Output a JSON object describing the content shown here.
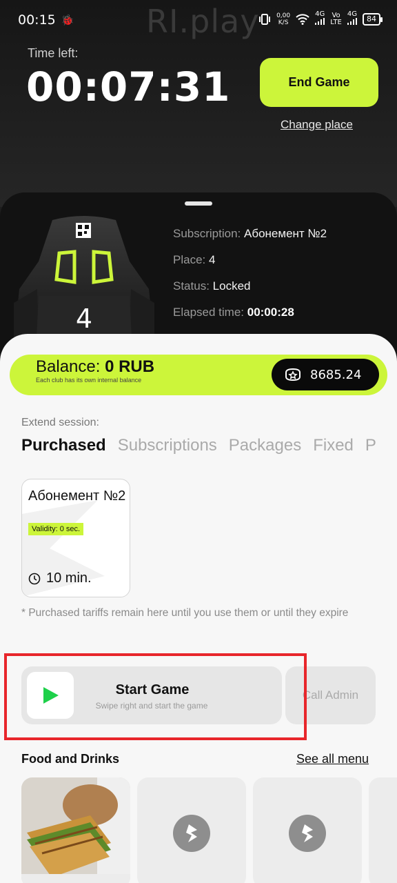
{
  "status_bar": {
    "time": "00:15",
    "net_speed_value": "0,00",
    "net_speed_unit": "K/S",
    "sig1": "4G",
    "volte": "Vo",
    "volte2": "LTE",
    "sig2": "4G",
    "battery": "84"
  },
  "brand_watermark": "RI.play",
  "header": {
    "time_left_label": "Time left:",
    "timer": "00:07:31",
    "end_game_label": "End Game",
    "change_place_label": "Change place"
  },
  "seat": {
    "place_number": "4",
    "subscription_label": "Subscription:",
    "subscription_value": "Абонемент №2",
    "place_label": "Place:",
    "place_value": "4",
    "status_label": "Status:",
    "status_value": "Locked",
    "elapsed_label": "Elapsed time:",
    "elapsed_value": "00:00:28"
  },
  "balance": {
    "label": "Balance:",
    "value": "0 RUB",
    "subtitle": "Each club has its own internal balance",
    "bonus_value": "8685.24"
  },
  "extend": {
    "label": "Extend session:",
    "tabs": [
      "Purchased",
      "Subscriptions",
      "Packages",
      "Fixed",
      "P"
    ]
  },
  "subscription_card": {
    "name": "Абонемент №2",
    "validity": "Validity: 0 sec.",
    "duration": "10 min."
  },
  "note": "* Purchased tariffs remain here until you use them or until they expire",
  "start_game": {
    "title": "Start Game",
    "subtitle": "Swipe right and start the game"
  },
  "call_admin_label": "Call Admin",
  "food": {
    "title": "Food and Drinks",
    "see_all_label": "See all menu"
  },
  "colors": {
    "accent": "#ccf53a",
    "dark": "#121212",
    "highlight": "#e8262b"
  }
}
